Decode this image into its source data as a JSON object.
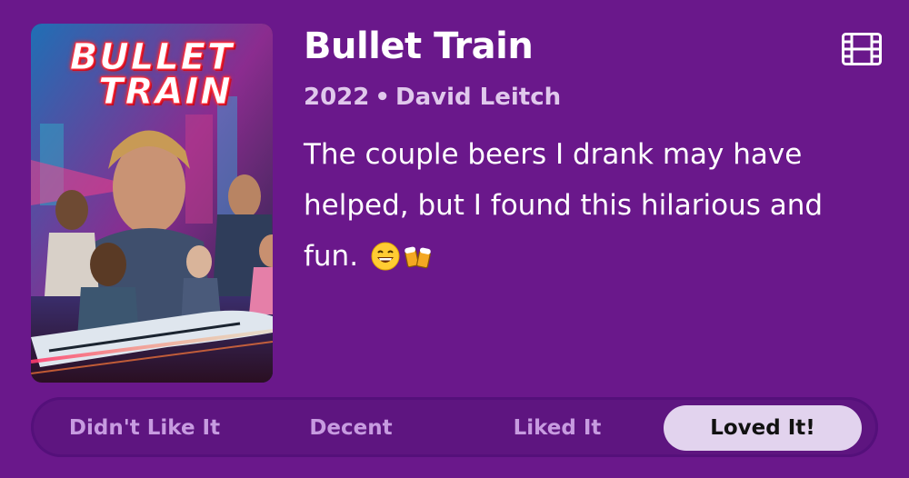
{
  "movie": {
    "title": "Bullet Train",
    "year": "2022",
    "separator": "•",
    "director": "David Leitch",
    "review": "The couple beers I drank may have helped, but I found this hilarious and fun.",
    "review_emojis": [
      "grinning-face",
      "beer-mugs"
    ],
    "poster": {
      "title_line1": "BULLET",
      "title_line2": "TRAIN"
    }
  },
  "type_icon": "film-icon",
  "rating": {
    "options": [
      {
        "label": "Didn't Like It",
        "selected": false
      },
      {
        "label": "Decent",
        "selected": false
      },
      {
        "label": "Liked It",
        "selected": false
      },
      {
        "label": "Loved It!",
        "selected": true
      }
    ]
  },
  "colors": {
    "background": "#6a188b",
    "meta_text": "#e0c8ec",
    "rating_bar": "#5e1580",
    "rating_inactive_text": "#c79be0",
    "rating_selected_bg": "#e2d3ee",
    "rating_selected_text": "#111111"
  }
}
